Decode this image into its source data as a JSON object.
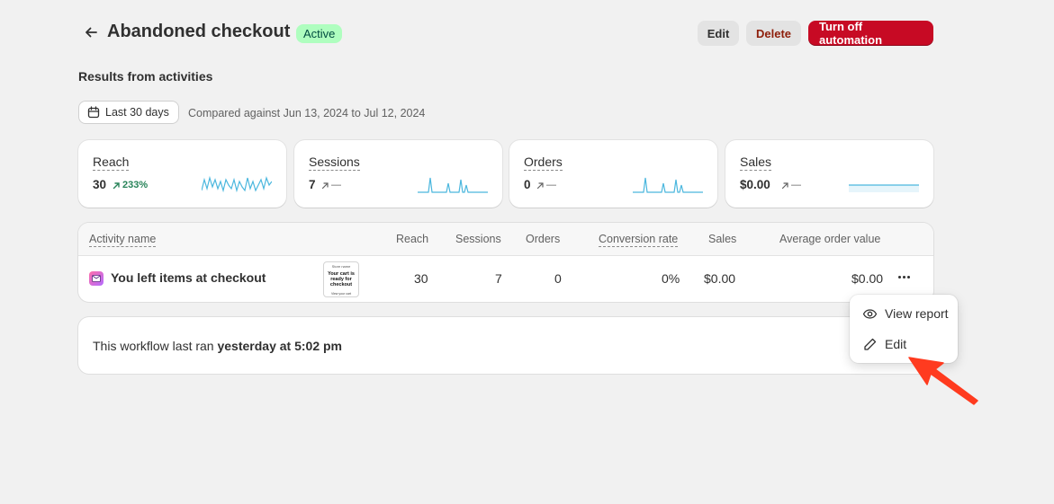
{
  "header": {
    "title": "Abandoned checkout",
    "status_badge": "Active",
    "edit_label": "Edit",
    "delete_label": "Delete",
    "turn_off_label": "Turn off automation"
  },
  "results": {
    "title": "Results from activities",
    "date_range_label": "Last 30 days",
    "compare_text": "Compared against Jun 13, 2024 to Jul 12, 2024"
  },
  "metrics": [
    {
      "label": "Reach",
      "value": "30",
      "delta": "233%"
    },
    {
      "label": "Sessions",
      "value": "7",
      "delta": "—"
    },
    {
      "label": "Orders",
      "value": "0",
      "delta": "—"
    },
    {
      "label": "Sales",
      "value": "$0.00",
      "delta": "—"
    }
  ],
  "table": {
    "headers": [
      "Activity name",
      "Reach",
      "Sessions",
      "Orders",
      "Conversion rate",
      "Sales",
      "Average order value"
    ],
    "row": {
      "name": "You left items at checkout",
      "thumb_small": "Store name",
      "thumb_title": "Your cart is ready for checkout",
      "thumb_footer": "View your cart",
      "reach": "30",
      "sessions": "7",
      "orders": "0",
      "conversion_rate": "0%",
      "sales": "$0.00",
      "average_order_value": "$0.00"
    }
  },
  "info": {
    "text_prefix": "This workflow last ran ",
    "text_bold": "yesterday at 5:02 pm"
  },
  "menu": {
    "items": [
      {
        "label": "View report",
        "icon": "eye-icon"
      },
      {
        "label": "Edit",
        "icon": "pencil-icon"
      }
    ]
  },
  "colors": {
    "accent_red": "#c70a24",
    "badge_green": "#affebf",
    "positive_green": "#29845a",
    "sparkline_blue": "#4bb7de",
    "annotation_arrow": "#ff3b1f"
  }
}
